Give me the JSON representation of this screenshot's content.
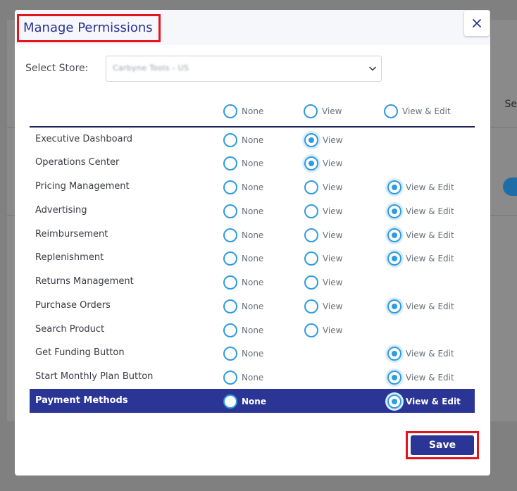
{
  "background": {
    "right_text": "Se"
  },
  "modal": {
    "title": "Manage Permissions",
    "close_glyph": "✕"
  },
  "store": {
    "label": "Select Store:",
    "value": "Carbyne Tools - US"
  },
  "columns": {
    "none": "None",
    "view": "View",
    "view_edit": "View & Edit"
  },
  "permissions": [
    {
      "name": "Executive Dashboard",
      "none": "None",
      "view": "View",
      "view_edit": "",
      "selected": "view"
    },
    {
      "name": "Operations Center",
      "none": "None",
      "view": "View",
      "view_edit": "",
      "selected": "view"
    },
    {
      "name": "Pricing Management",
      "none": "None",
      "view": "View",
      "view_edit": "View & Edit",
      "selected": "view_edit"
    },
    {
      "name": "Advertising",
      "none": "None",
      "view": "View",
      "view_edit": "View & Edit",
      "selected": "view_edit"
    },
    {
      "name": "Reimbursement",
      "none": "None",
      "view": "View",
      "view_edit": "View & Edit",
      "selected": "view_edit"
    },
    {
      "name": "Replenishment",
      "none": "None",
      "view": "View",
      "view_edit": "View & Edit",
      "selected": "view_edit"
    },
    {
      "name": "Returns Management",
      "none": "None",
      "view": "View",
      "view_edit": "",
      "selected": "none_unset"
    },
    {
      "name": "Purchase Orders",
      "none": "None",
      "view": "View",
      "view_edit": "View & Edit",
      "selected": "view_edit"
    },
    {
      "name": "Search Product",
      "none": "None",
      "view": "View",
      "view_edit": "",
      "selected": "none_unset"
    },
    {
      "name": "Get Funding Button",
      "none": "None",
      "view": "",
      "view_edit": "View & Edit",
      "selected": "view_edit"
    },
    {
      "name": "Start Monthly Plan Button",
      "none": "None",
      "view": "",
      "view_edit": "View & Edit",
      "selected": "view_edit"
    },
    {
      "name": "Payment Methods",
      "none": "None",
      "view": "",
      "view_edit": "View & Edit",
      "selected": "view_edit"
    }
  ],
  "footer": {
    "save_label": "Save"
  },
  "colors": {
    "accent": "#2f9be0",
    "primary": "#2b3595",
    "highlight_border": "#e3141b"
  }
}
